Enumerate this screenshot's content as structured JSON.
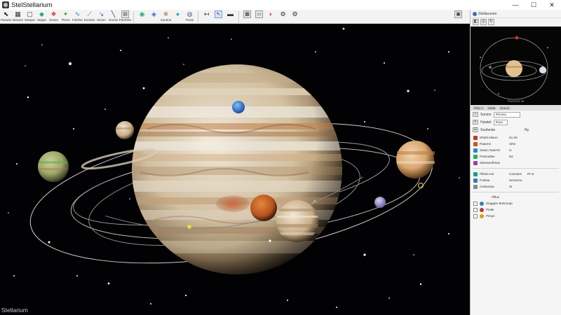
{
  "window": {
    "title": "StelStellarium",
    "minimize": "—",
    "maximize": "☐",
    "close": "✕"
  },
  "toolbar": {
    "left_labels": [
      "Pseudo",
      "Dissum",
      "Seepac",
      "Seppe",
      "Sunes",
      "Thuns",
      "Fulsher",
      "Dorsian",
      "Sisom",
      "Dorcte",
      "Panmtes"
    ],
    "mid_labels": [
      "Sourine",
      "Pusie"
    ]
  },
  "sky": {
    "label": "Stellarium"
  },
  "panel": {
    "title": "Stellasurum",
    "preview_caption": "Pinemmt sk",
    "preview_tabs": [
      "Plan 1",
      "Hidat",
      "Sonun"
    ],
    "search_label": "Sunion",
    "search_value": "Pennsa",
    "search2_label": "Hyiatet",
    "search2_value": "Ropu",
    "subheader": "Seaheste",
    "subheader_val": "Ny",
    "rows_a": [
      {
        "name": "Sheld etieun",
        "val": "Su ds",
        "color": "#c0392b"
      },
      {
        "name": "Raanne",
        "val": "Sihe",
        "color": "#d35400"
      },
      {
        "name": "Siaeio Saerrst",
        "val": "io",
        "color": "#2e86c1"
      },
      {
        "name": "Pasnadiee",
        "val": "iss",
        "color": "#27ae60"
      },
      {
        "name": "Siiseaerdhsoe",
        "val": "",
        "color": "#8e44ad"
      }
    ],
    "rows_b": [
      {
        "name": "Plbzte eie",
        "val": "Cansses",
        "val2": "Pn 5",
        "color": "#16a085"
      },
      {
        "name": "Puhtsa",
        "val": "Smnerse",
        "val2": "",
        "color": "#2980b9"
      },
      {
        "name": "Ceeluniaa",
        "val": "Sr",
        "val2": "",
        "color": "#7f8c8d"
      }
    ],
    "tree_header": "Plllus",
    "tree_rows": [
      {
        "label": "Staggee Bosmuep",
        "color": "#2e86c1"
      },
      {
        "label": "Piuite",
        "color": "#c0392b"
      },
      {
        "label": "Pimys",
        "color": "#d4a017"
      }
    ]
  }
}
